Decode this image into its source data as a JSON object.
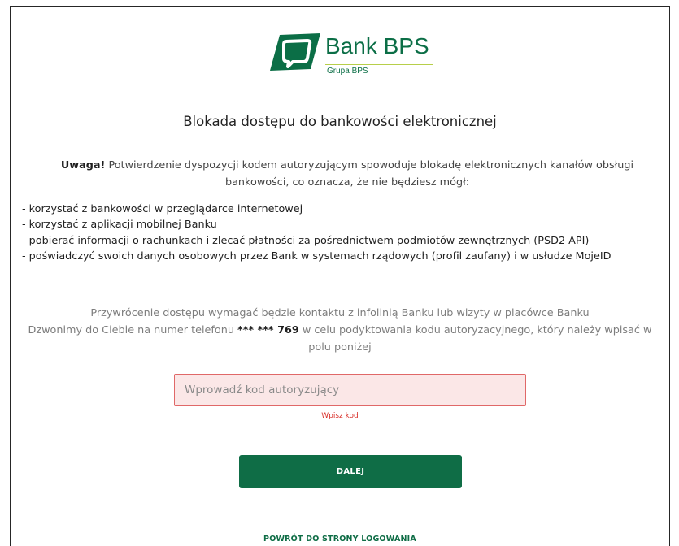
{
  "logo": {
    "brand": "Bank BPS",
    "subtitle": "Grupa BPS",
    "color": "#0b6e46",
    "accent": "#b7cf4a"
  },
  "title": "Blokada dostępu do bankowości elektronicznej",
  "warning": {
    "bold": "Uwaga!",
    "text": " Potwierdzenie dyspozycji kodem autoryzującym spowoduje blokadę elektronicznych kanałów obsługi bankowości, co oznacza, że nie będziesz mógł:"
  },
  "consequences": [
    "- korzystać z bankowości w przeglądarce internetowej",
    "- korzystać z aplikacji mobilnej Banku",
    "- pobierać informacji o rachunkach i zlecać płatności za pośrednictwem podmiotów zewnętrznych (PSD2 API)",
    "- poświadczyć swoich danych osobowych przez Bank w systemach rządowych (profil zaufany) i w usłudze MojeID"
  ],
  "info": {
    "line1": "Przywrócenie dostępu wymagać będzie kontaktu z infolinią Banku lub wizyty w placówce Banku",
    "line2_prefix": "Dzwonimy do Ciebie na numer telefonu ",
    "phone_masked": "*** *** 769",
    "line2_suffix": " w celu podyktowania kodu autoryzacyjnego, który należy wpisać w polu poniżej"
  },
  "code_field": {
    "placeholder": "Wprowadź kod autoryzujący",
    "value": "",
    "error": "Wpisz kod"
  },
  "buttons": {
    "next": "DALEJ",
    "back": "POWRÓT DO STRONY LOGOWANIA"
  },
  "colors": {
    "primary": "#0f6d46",
    "error": "#d9302a",
    "error_bg": "#fbe7e7"
  }
}
